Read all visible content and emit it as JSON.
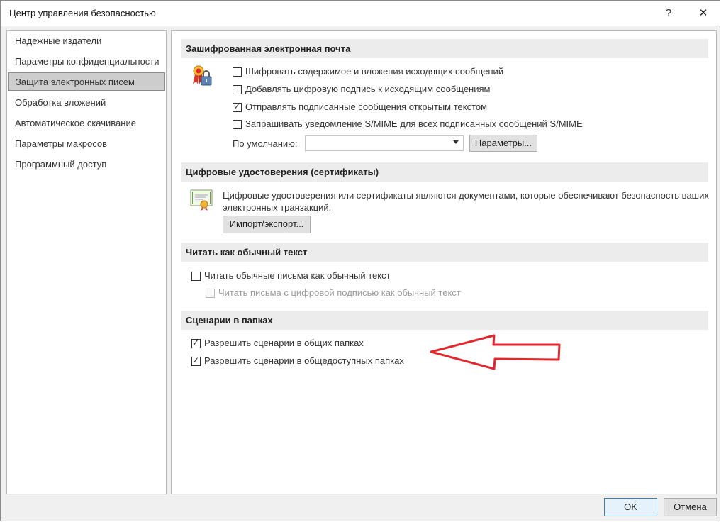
{
  "window": {
    "title": "Центр управления безопасностью",
    "help_glyph": "?",
    "close_glyph": "✕"
  },
  "sidebar": {
    "items": [
      {
        "label": "Надежные издатели",
        "selected": false
      },
      {
        "label": "Параметры конфиденциальности",
        "selected": false
      },
      {
        "label": "Защита электронных писем",
        "selected": true
      },
      {
        "label": "Обработка вложений",
        "selected": false
      },
      {
        "label": "Автоматическое скачивание",
        "selected": false
      },
      {
        "label": "Параметры макросов",
        "selected": false
      },
      {
        "label": "Программный доступ",
        "selected": false
      }
    ]
  },
  "encrypted_email": {
    "header": "Зашифрованная электронная почта",
    "icon": "certificate-lock-icon",
    "options": [
      {
        "label": "Шифровать содержимое и вложения исходящих сообщений",
        "checked": false
      },
      {
        "label": "Добавлять цифровую подпись к исходящим сообщениям",
        "checked": false
      },
      {
        "label": "Отправлять подписанные сообщения открытым текстом",
        "checked": true
      },
      {
        "label": "Запрашивать уведомление S/MIME для всех подписанных сообщений S/MIME",
        "checked": false
      }
    ],
    "default_label": "По умолчанию:",
    "default_value": "",
    "settings_button": "Параметры..."
  },
  "digital_ids": {
    "header": "Цифровые удостоверения (сертификаты)",
    "icon": "certificate-icon",
    "description_line1": "Цифровые удостоверения или сертификаты являются документами, которые обеспечивают безопасность ваших",
    "description_line2": "электронных транзакций.",
    "import_export_button": "Импорт/экспорт..."
  },
  "read_plain": {
    "header": "Читать как обычный текст",
    "options": [
      {
        "label": "Читать обычные письма как обычный текст",
        "checked": false,
        "disabled": false
      },
      {
        "label": "Читать письма с цифровой подписью как обычный текст",
        "checked": false,
        "disabled": true
      }
    ]
  },
  "folder_scripts": {
    "header": "Сценарии в папках",
    "options": [
      {
        "label": "Разрешить сценарии в общих папках",
        "checked": true
      },
      {
        "label": "Разрешить сценарии в общедоступных папках",
        "checked": true
      }
    ]
  },
  "footer": {
    "ok_button": "OK",
    "cancel_button": "Отмена"
  },
  "colors": {
    "annotation_arrow": "#e0282e",
    "selected_nav": "#cdcdcd",
    "section_header_bg": "#ececec"
  }
}
